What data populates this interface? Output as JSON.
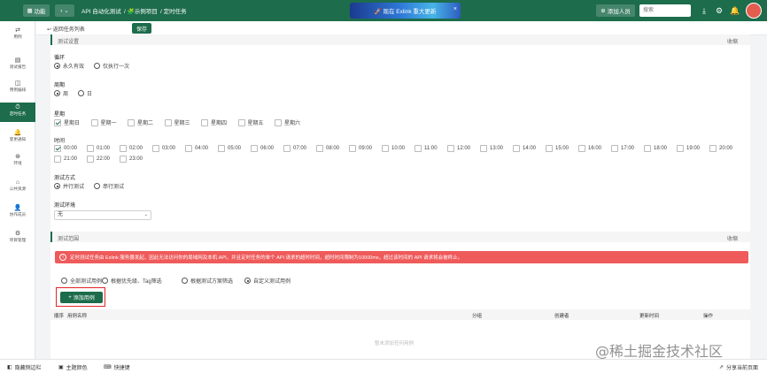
{
  "topbar": {
    "menu_label": "功能",
    "crumbs": [
      "API 自动化测试",
      "/ 🧩示例项目",
      "/ 定时任务"
    ],
    "banner_text": "🚀 现在 Exlink 重大更新",
    "add_member": "添加人员",
    "search_placeholder": "搜索"
  },
  "sidebar": {
    "items": [
      {
        "icon": "⇄",
        "label": "用例"
      },
      {
        "icon": "▤",
        "label": "测试报告"
      },
      {
        "icon": "◫",
        "label": "用例编排"
      },
      {
        "icon": "⏱",
        "label": "定时任务"
      },
      {
        "icon": "🔔",
        "label": "变更通知"
      },
      {
        "icon": "⊛",
        "label": "环境"
      },
      {
        "icon": "⌂",
        "label": "公共资源"
      },
      {
        "icon": "👤",
        "label": "协作成员"
      },
      {
        "icon": "⚙",
        "label": "项目管理"
      }
    ]
  },
  "toolbar": {
    "back_label": "返回任务列表",
    "save_label": "保存"
  },
  "schedule": {
    "section_title": "测试设置",
    "collapse_label": "收缩",
    "loop_label": "循环",
    "loop_options": [
      "永久有效",
      "仅执行一次"
    ],
    "period_label": "周期",
    "period_options": [
      "周",
      "日"
    ],
    "weekday_label": "星期",
    "weekdays": [
      "星期日",
      "星期一",
      "星期二",
      "星期三",
      "星期四",
      "星期五",
      "星期六"
    ],
    "time_label": "时间",
    "times": [
      "00:00",
      "01:00",
      "02:00",
      "03:00",
      "04:00",
      "05:00",
      "06:00",
      "07:00",
      "08:00",
      "09:00",
      "10:00",
      "11:00",
      "12:00",
      "13:00",
      "14:00",
      "15:00",
      "16:00",
      "17:00",
      "18:00",
      "19:00",
      "20:00",
      "21:00",
      "22:00",
      "23:00"
    ],
    "mode_label": "测试方式",
    "mode_options": [
      "并行测试",
      "串行测试"
    ],
    "env_label": "测试环境",
    "env_value": "无"
  },
  "scope": {
    "section_title": "测试范围",
    "collapse_label": "收缩",
    "alert": "定时测试任务由 Exlink 服务器发起，因此无法访问你的局域网及本机 API，并且定时任务的单个 API 请求的超时时间，超时时间限制为10000ms，超过该时间的 API 请求将会被终止。",
    "filters": [
      "全部测试用例",
      "根据优先级、Tag筛选",
      "根据测试方案筛选",
      "自定义测试用例"
    ],
    "add_case": "添加用例",
    "columns": [
      "顺序",
      "用例名称",
      "分组",
      "创建者",
      "更新时间",
      "操作"
    ],
    "empty_text": "暂未添加任何用例"
  },
  "bottom": {
    "hide_sidebar": "隐藏侧边栏",
    "theme": "主题颜色",
    "shortcuts": "快捷键",
    "share": "分享当前页面"
  },
  "watermark": "@稀土掘金技术社区"
}
